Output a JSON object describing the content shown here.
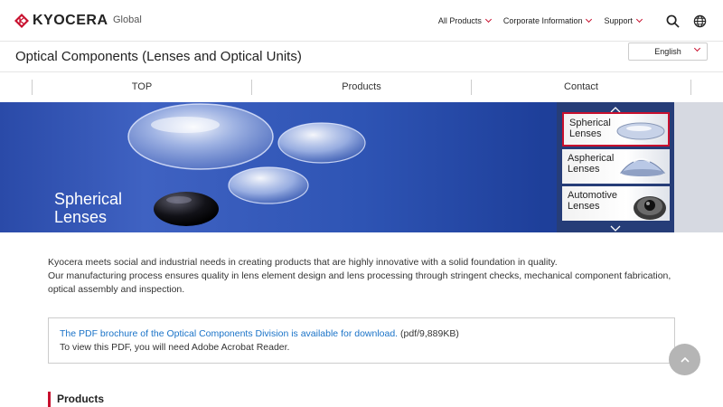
{
  "header": {
    "brand": "KYOCERA",
    "region": "Global",
    "nav": [
      {
        "label": "All Products"
      },
      {
        "label": "Corporate Information"
      },
      {
        "label": "Support"
      }
    ],
    "icons": [
      "search-icon",
      "globe-icon"
    ]
  },
  "title_bar": {
    "title": "Optical Components (Lenses and Optical Units)",
    "language": "English"
  },
  "subnav": [
    {
      "label": "TOP"
    },
    {
      "label": "Products"
    },
    {
      "label": "Contact"
    }
  ],
  "hero": {
    "title_line1": "Spherical",
    "title_line2": "Lenses"
  },
  "carousel": {
    "items": [
      {
        "line1": "Spherical",
        "line2": "Lenses",
        "active": true
      },
      {
        "line1": "Aspherical",
        "line2": "Lenses",
        "active": false
      },
      {
        "line1": "Automotive",
        "line2": "Lenses",
        "active": false
      }
    ]
  },
  "intro": {
    "p1": "Kyocera meets social and industrial needs in creating products that are highly innovative with a solid foundation in quality.",
    "p2": "Our manufacturing process ensures quality in lens element design and lens processing through stringent checks, mechanical component fabrication, optical assembly and inspection."
  },
  "pdf": {
    "link_text": "The PDF brochure of the Optical Components Division is available for download.",
    "meta": "(pdf/9,889KB)",
    "note": "To view this PDF, you will need Adobe Acrobat Reader."
  },
  "section": {
    "title": "Products"
  },
  "colors": {
    "accent": "#c8102e",
    "link": "#1a73c8",
    "hero_blue": "#2e54b4"
  }
}
